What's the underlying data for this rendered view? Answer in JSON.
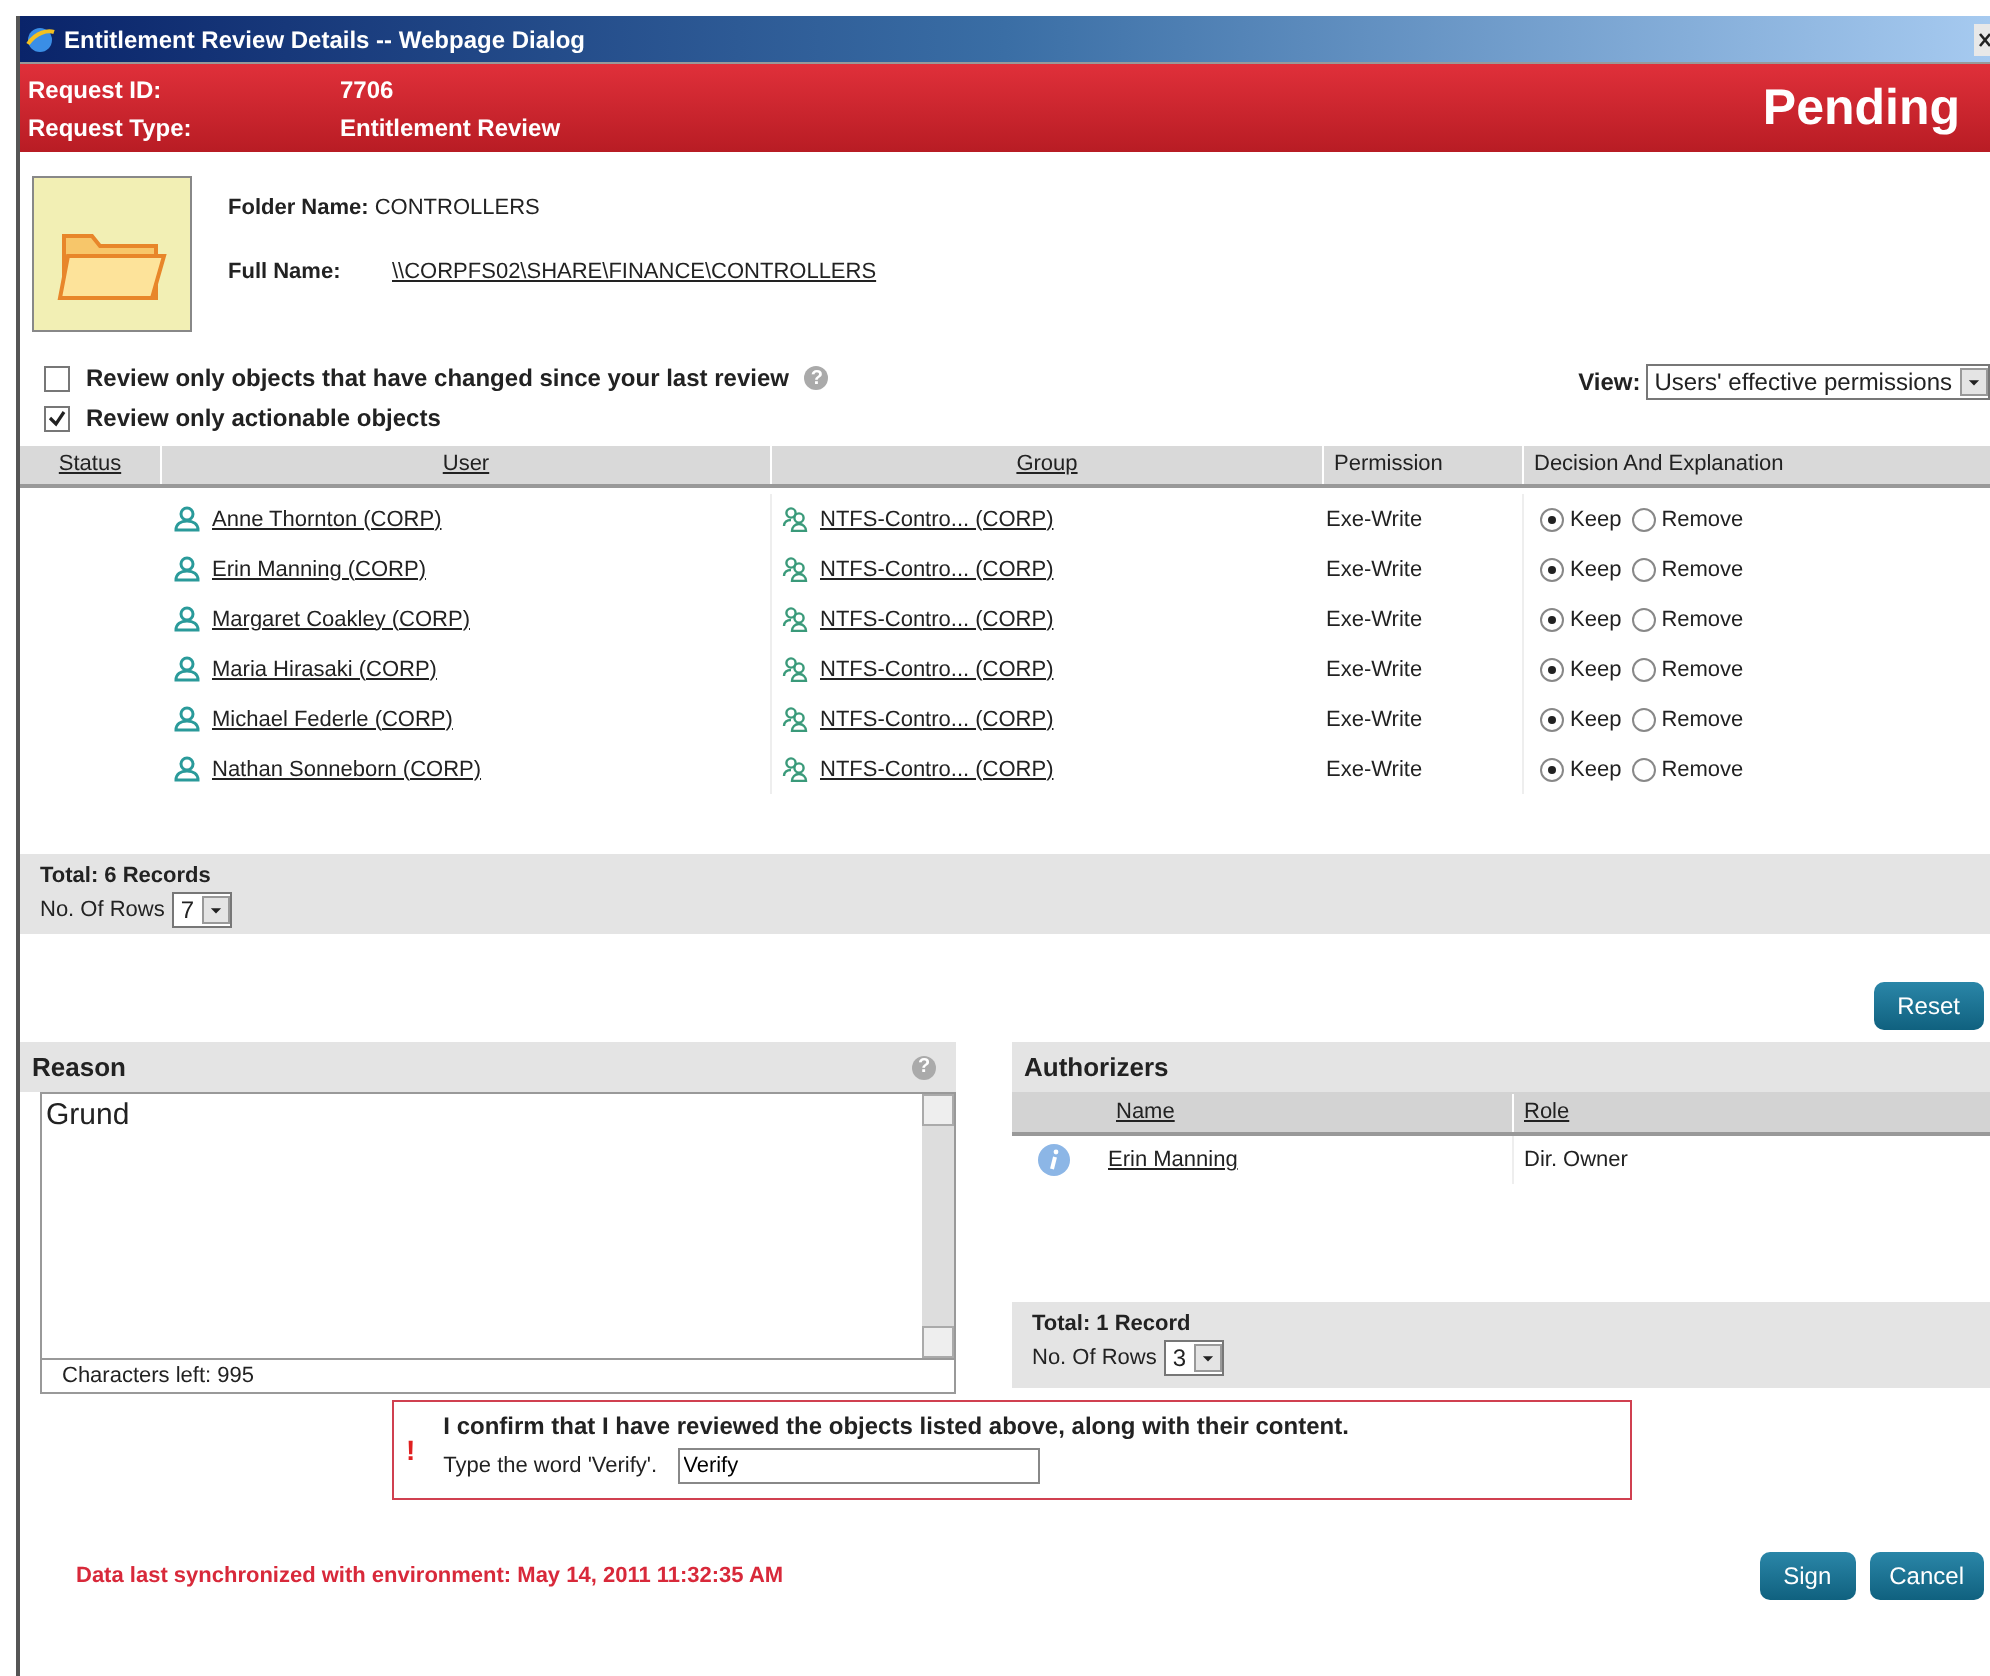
{
  "window": {
    "title": "Entitlement Review Details -- Webpage Dialog"
  },
  "header": {
    "fields": [
      {
        "label": "Request ID:",
        "value": "7706"
      },
      {
        "label": "Request Type:",
        "value": "Entitlement Review"
      }
    ],
    "status": "Pending"
  },
  "folder": {
    "name_label": "Folder Name:",
    "name": "CONTROLLERS",
    "full_name_label": "Full Name:",
    "full_name": "\\\\CORPFS02\\SHARE\\FINANCE\\CONTROLLERS"
  },
  "filters": [
    {
      "label": "Review only objects that have changed since your last review",
      "checked": false,
      "help": "?"
    },
    {
      "label": "Review only actionable objects",
      "checked": true
    }
  ],
  "view": {
    "label": "View:",
    "value": "Users' effective permissions"
  },
  "table": {
    "columns": [
      "Status",
      "User",
      "Group",
      "Permission",
      "Decision And Explanation"
    ],
    "rows": [
      {
        "user": "Anne Thornton (CORP)",
        "group": "NTFS-Contro... (CORP)",
        "permission": "Exe-Write",
        "decision": [
          {
            "label": "Keep",
            "selected": true
          },
          {
            "label": "Remove",
            "selected": false
          }
        ]
      },
      {
        "user": "Erin Manning (CORP)",
        "group": "NTFS-Contro... (CORP)",
        "permission": "Exe-Write",
        "decision": [
          {
            "label": "Keep",
            "selected": true
          },
          {
            "label": "Remove",
            "selected": false
          }
        ]
      },
      {
        "user": "Margaret Coakley (CORP)",
        "group": "NTFS-Contro... (CORP)",
        "permission": "Exe-Write",
        "decision": [
          {
            "label": "Keep",
            "selected": true
          },
          {
            "label": "Remove",
            "selected": false
          }
        ]
      },
      {
        "user": "Maria Hirasaki (CORP)",
        "group": "NTFS-Contro... (CORP)",
        "permission": "Exe-Write",
        "decision": [
          {
            "label": "Keep",
            "selected": true
          },
          {
            "label": "Remove",
            "selected": false
          }
        ]
      },
      {
        "user": "Michael Federle (CORP)",
        "group": "NTFS-Contro... (CORP)",
        "permission": "Exe-Write",
        "decision": [
          {
            "label": "Keep",
            "selected": true
          },
          {
            "label": "Remove",
            "selected": false
          }
        ]
      },
      {
        "user": "Nathan Sonneborn (CORP)",
        "group": "NTFS-Contro... (CORP)",
        "permission": "Exe-Write",
        "decision": [
          {
            "label": "Keep",
            "selected": true
          },
          {
            "label": "Remove",
            "selected": false
          }
        ]
      }
    ],
    "total": "Total: 6 Records",
    "rows_label": "No. Of Rows",
    "rows_value": "7"
  },
  "reset_button": "Reset",
  "reason": {
    "title": "Reason",
    "help": "?",
    "value": "Grund",
    "chars_left": "Characters left: 995"
  },
  "authorizers": {
    "title": "Authorizers",
    "columns": [
      "Name",
      "Role"
    ],
    "rows": [
      {
        "name": "Erin Manning",
        "role": "Dir. Owner"
      }
    ],
    "total": "Total: 1 Record",
    "rows_label": "No. Of Rows",
    "rows_value": "3"
  },
  "confirm": {
    "mark": "!",
    "text": "I confirm that I have reviewed the objects listed above, along with their content.",
    "prompt": "Type the word 'Verify'.",
    "value": "Verify"
  },
  "sync": "Data last synchronized with environment: May 14, 2011 11:32:35 AM",
  "buttons": [
    "Sign",
    "Cancel"
  ]
}
